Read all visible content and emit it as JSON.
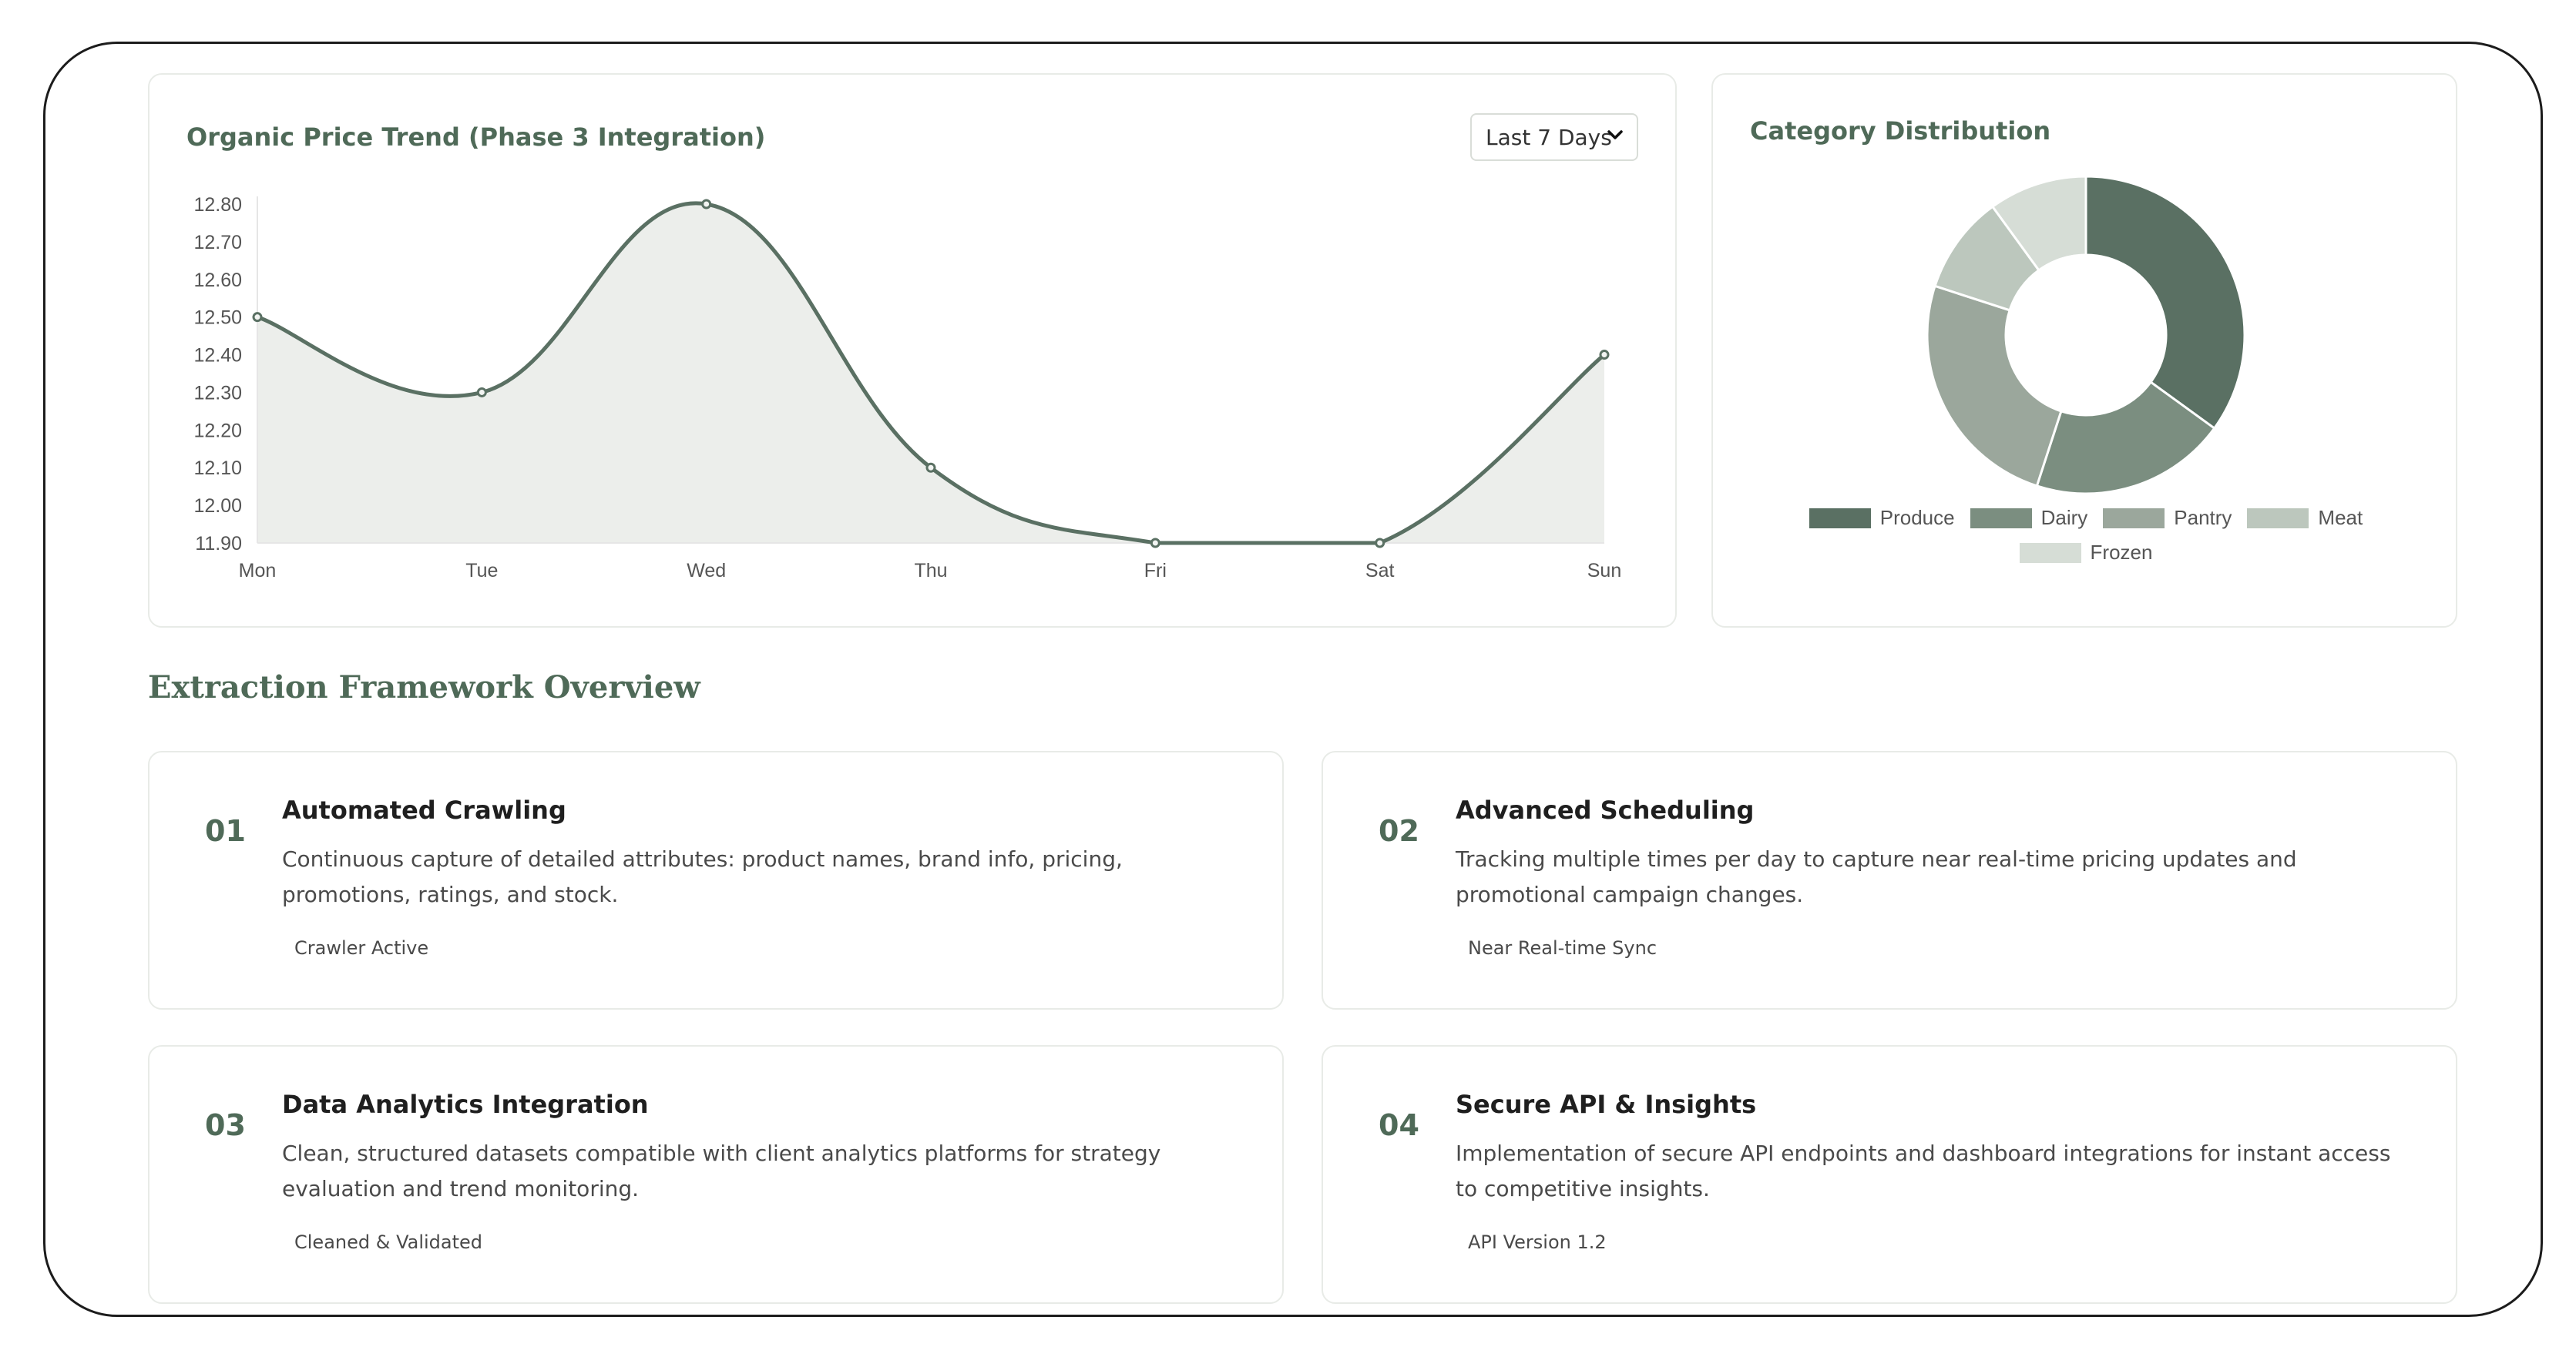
{
  "trend_card": {
    "title": "Organic Price Trend (Phase 3 Integration)",
    "range_select": {
      "value": "Last 7 Days"
    }
  },
  "dist_card": {
    "title": "Category Distribution"
  },
  "colors": {
    "accent": "#4f6a58",
    "line": "#5a7063",
    "fill": "#eceeeb"
  },
  "chart_data": [
    {
      "type": "line",
      "title": "Organic Price Trend (Phase 3 Integration)",
      "categories": [
        "Mon",
        "Tue",
        "Wed",
        "Thu",
        "Fri",
        "Sat",
        "Sun"
      ],
      "series": [
        {
          "values": [
            12.5,
            12.3,
            12.8,
            12.1,
            11.9,
            11.9,
            12.4
          ]
        }
      ],
      "ylim": [
        11.9,
        12.8
      ],
      "yticks": [
        "12.80",
        "12.70",
        "12.60",
        "12.50",
        "12.40",
        "12.30",
        "12.20",
        "12.10",
        "12.00",
        "11.90"
      ],
      "fill": true,
      "grid": false
    },
    {
      "type": "pie",
      "title": "Category Distribution",
      "donut": true,
      "labels": [
        "Produce",
        "Dairy",
        "Pantry",
        "Meat",
        "Frozen"
      ],
      "values": [
        35,
        20,
        25,
        10,
        10
      ],
      "colors": [
        "#5a7063",
        "#7b8e80",
        "#9ba79c",
        "#bcc7bd",
        "#d6ddd6"
      ],
      "legend": "bottom"
    }
  ],
  "overview": {
    "title": "Extraction Framework Overview",
    "items": [
      {
        "num": "01",
        "title": "Automated Crawling",
        "desc": "Continuous capture of detailed attributes: product names, brand info, pricing, promotions, ratings, and stock.",
        "badge": "Crawler Active"
      },
      {
        "num": "02",
        "title": "Advanced Scheduling",
        "desc": "Tracking multiple times per day to capture near real-time pricing updates and promotional campaign changes.",
        "badge": "Near Real-time Sync"
      },
      {
        "num": "03",
        "title": "Data Analytics Integration",
        "desc": "Clean, structured datasets compatible with client analytics platforms for strategy evaluation and trend monitoring.",
        "badge": "Cleaned & Validated"
      },
      {
        "num": "04",
        "title": "Secure API & Insights",
        "desc": "Implementation of secure API endpoints and dashboard integrations for instant access to competitive insights.",
        "badge": "API Version 1.2"
      }
    ]
  }
}
